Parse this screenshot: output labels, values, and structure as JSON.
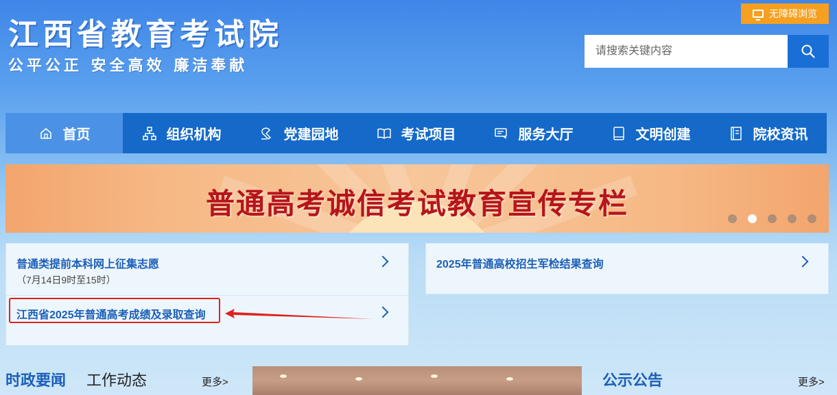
{
  "header": {
    "title": "江西省教育考试院",
    "slogan": "公平公正  安全高效  廉洁奉献",
    "accessibility_label": "无障碍浏览"
  },
  "search": {
    "placeholder": "请搜索关键内容",
    "button_icon": "search-icon"
  },
  "nav": {
    "items": [
      {
        "label": "首页",
        "icon": "home-icon"
      },
      {
        "label": "组织机构",
        "icon": "org-chart-icon"
      },
      {
        "label": "党建园地",
        "icon": "party-icon"
      },
      {
        "label": "考试项目",
        "icon": "book-icon"
      },
      {
        "label": "服务大厅",
        "icon": "service-icon"
      },
      {
        "label": "文明创建",
        "icon": "notebook-icon"
      },
      {
        "label": "院校资讯",
        "icon": "document-icon"
      }
    ],
    "active_index": 0
  },
  "banner": {
    "title": "普通高考诚信考试教育宣传专栏",
    "slide_count": 5,
    "active_slide": 2
  },
  "quick_links": {
    "left": [
      {
        "title": "普通类提前本科网上征集志愿",
        "sub": "（7月14日9时至15时）"
      },
      {
        "title": "江西省2025年普通高考成绩及录取查询"
      }
    ],
    "right": [
      {
        "title": "2025年普通高校招生军检结果查询"
      }
    ]
  },
  "sections": {
    "news_tab_active": "时政要闻",
    "news_tab_other": "工作动态",
    "news_more": "更多>",
    "notice_title": "公示公告",
    "notice_more": "更多>"
  },
  "colors": {
    "nav_bg": "#1469c9",
    "nav_active": "#4b92e6",
    "accent_orange": "#f5a021",
    "link_blue": "#1a5fb8",
    "banner_red": "#b6151b",
    "highlight_red": "#e0201e"
  }
}
